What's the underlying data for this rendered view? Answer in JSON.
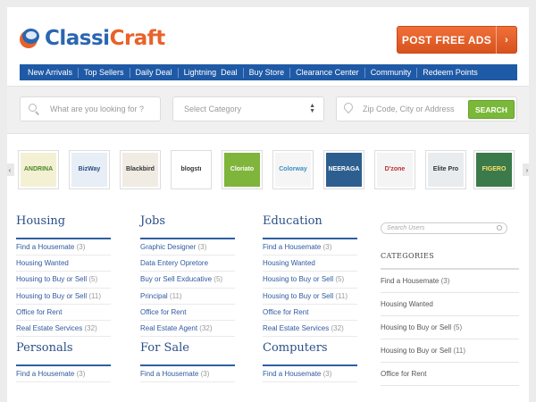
{
  "header": {
    "logo_part1": "Classi",
    "logo_part2": "Craft",
    "post_button": "POST FREE ADS",
    "post_arrow": "›"
  },
  "nav": [
    "New Arrivals",
    "Top Sellers",
    "Daily Deal",
    "Lightning  Deal",
    "Buy Store",
    "Clearance Center",
    "Community",
    "Redeem Points"
  ],
  "search": {
    "keyword_placeholder": "What are you looking for ?",
    "category_placeholder": "Select Category",
    "location_placeholder": "Zip Code, City or Address",
    "button": "SEARCH"
  },
  "carousel": {
    "prev": "‹",
    "next": "›",
    "items": [
      {
        "label": "ANDRINA",
        "bg": "#f4f0d4",
        "fg": "#4a8a2a"
      },
      {
        "label": "BizWay",
        "bg": "#e8eef5",
        "fg": "#2a4f86"
      },
      {
        "label": "Blackbird",
        "bg": "#f0ece4",
        "fg": "#333333"
      },
      {
        "label": "blogstı",
        "bg": "#ffffff",
        "fg": "#333333"
      },
      {
        "label": "Cloriato",
        "bg": "#7fb53a",
        "fg": "#ffffff"
      },
      {
        "label": "Colorway",
        "bg": "#f5f5f5",
        "fg": "#3a8fc8"
      },
      {
        "label": "NEERAGA",
        "bg": "#2c5f8f",
        "fg": "#ffffff"
      },
      {
        "label": "D'zone",
        "bg": "#f4f4f4",
        "fg": "#c23030"
      },
      {
        "label": "Elite Pro",
        "bg": "#e9ecef",
        "fg": "#333333"
      },
      {
        "label": "FIGERO",
        "bg": "#3b7a4a",
        "fg": "#ffe36a"
      }
    ]
  },
  "columns_row1": [
    {
      "title": "Housing",
      "links": [
        {
          "text": "Find a Housemate",
          "count": "(3)"
        },
        {
          "text": "Housing Wanted",
          "count": ""
        },
        {
          "text": "Housing to Buy or Sell",
          "count": "(5)"
        },
        {
          "text": "Housing to Buy or Sell",
          "count": "(11)"
        },
        {
          "text": "Office for Rent",
          "count": ""
        },
        {
          "text": "Real Estate Services",
          "count": "(32)"
        }
      ]
    },
    {
      "title": "Jobs",
      "links": [
        {
          "text": "Graphic Designer",
          "count": "(3)"
        },
        {
          "text": "Data Entery Opretore",
          "count": ""
        },
        {
          "text": "Buy or Sell Exducative",
          "count": "(5)"
        },
        {
          "text": "Principal",
          "count": "(11)"
        },
        {
          "text": "Office for Rent",
          "count": ""
        },
        {
          "text": "Real Estate Agent",
          "count": "(32)"
        }
      ]
    },
    {
      "title": "Education",
      "links": [
        {
          "text": "Find a Housemate",
          "count": "(3)"
        },
        {
          "text": "Housing Wanted",
          "count": ""
        },
        {
          "text": "Housing to Buy or Sell",
          "count": "(5)"
        },
        {
          "text": "Housing to Buy or Sell",
          "count": "(11)"
        },
        {
          "text": "Office for Rent",
          "count": ""
        },
        {
          "text": "Real Estate Services",
          "count": "(32)"
        }
      ]
    }
  ],
  "columns_row2": [
    {
      "title": "Personals",
      "links": [
        {
          "text": "Find a Housemate",
          "count": "(3)"
        }
      ]
    },
    {
      "title": "For Sale",
      "links": [
        {
          "text": "Find a Housemate",
          "count": "(3)"
        }
      ]
    },
    {
      "title": "Computers",
      "links": [
        {
          "text": "Find a Housemate",
          "count": "(3)"
        }
      ]
    }
  ],
  "sidebar": {
    "search_placeholder": "Search Users",
    "heading": "CATEGORIES",
    "links": [
      {
        "text": "Find a Housemate",
        "count": "(3)"
      },
      {
        "text": "Housing Wanted",
        "count": ""
      },
      {
        "text": "Housing to Buy or Sell",
        "count": "(5)"
      },
      {
        "text": "Housing to Buy or Sell",
        "count": "(11)"
      },
      {
        "text": "Office for Rent",
        "count": ""
      }
    ]
  }
}
